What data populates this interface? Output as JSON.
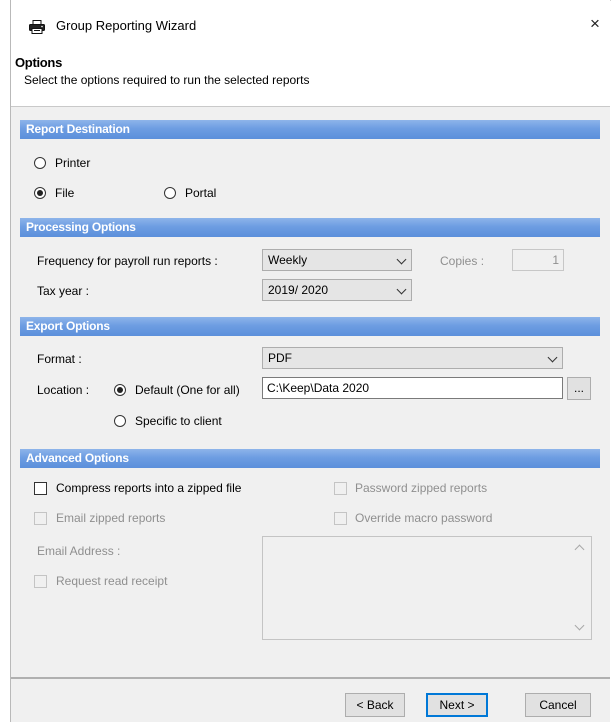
{
  "window": {
    "title": "Group Reporting Wizard",
    "icon": "printer-icon",
    "close_glyph": "×"
  },
  "header": {
    "title": "Options",
    "subtitle": "Select the options required to run the selected reports"
  },
  "report_destination": {
    "section_title": "Report Destination",
    "printer_label": "Printer",
    "file_label": "File",
    "portal_label": "Portal",
    "selected": "File"
  },
  "processing_options": {
    "section_title": "Processing Options",
    "frequency_label": "Frequency for payroll run reports :",
    "frequency_value": "Weekly",
    "copies_label": "Copies :",
    "copies_value": "1",
    "tax_year_label": "Tax year :",
    "tax_year_value": "2019/ 2020"
  },
  "export_options": {
    "section_title": "Export Options",
    "format_label": "Format :",
    "format_value": "PDF",
    "location_label": "Location :",
    "default_label": "Default (One for all)",
    "specific_label": "Specific to client",
    "location_selected": "Default (One for all)",
    "path_value": "C:\\Keep\\Data 2020",
    "browse_label": "..."
  },
  "advanced_options": {
    "section_title": "Advanced Options",
    "compress_label": "Compress reports into a zipped file",
    "compress_checked": false,
    "password_label": "Password zipped reports",
    "email_zipped_label": "Email zipped reports",
    "override_label": "Override macro password",
    "email_address_label": "Email Address :",
    "read_receipt_label": "Request read receipt"
  },
  "footer": {
    "back_label": "< Back",
    "next_label": "Next >",
    "cancel_label": "Cancel"
  },
  "colors": {
    "section_bar": "#6d9de2",
    "body_bg": "#f0f0f0",
    "disabled_text": "#8f8f8f"
  }
}
